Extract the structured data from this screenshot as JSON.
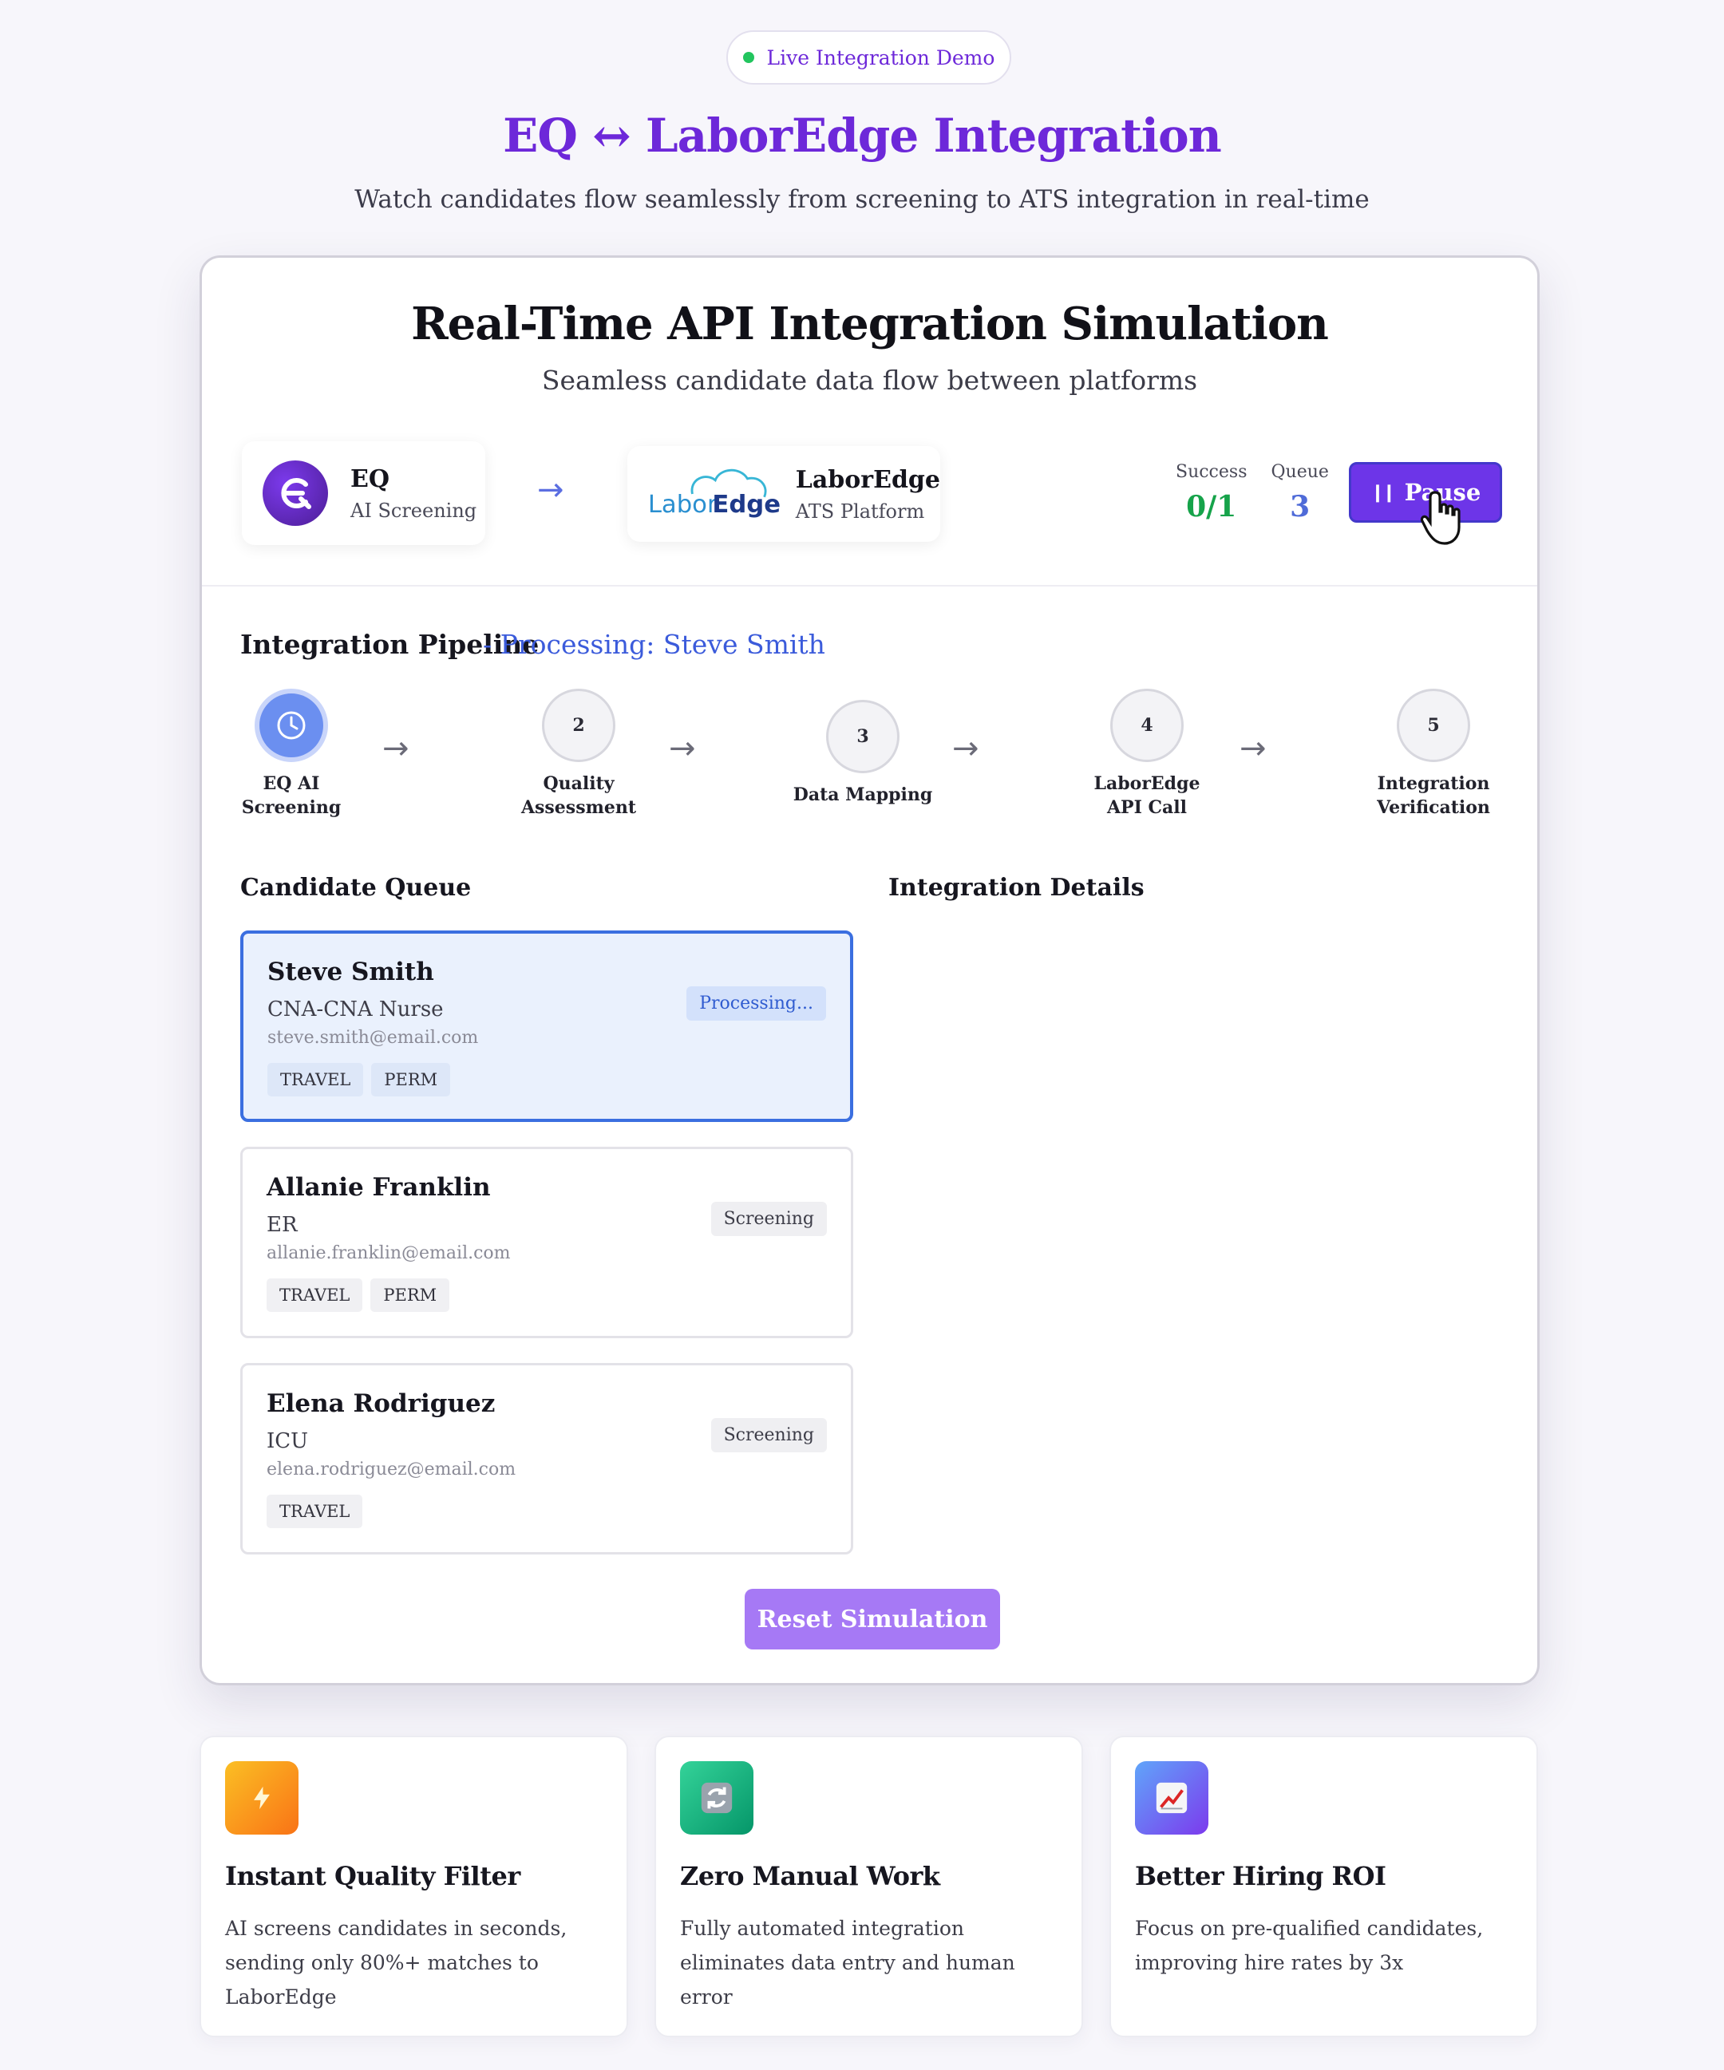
{
  "header": {
    "badge": "Live Integration Demo",
    "title": "EQ ↔ LaborEdge Integration",
    "subtitle": "Watch candidates flow seamlessly from screening to ATS integration in real-time"
  },
  "simulation": {
    "title": "Real-Time API Integration Simulation",
    "subtitle": "Seamless candidate data flow between platforms",
    "source": {
      "name": "EQ",
      "desc": "AI Screening",
      "icon": "eq-logo-icon"
    },
    "target": {
      "name": "LaborEdge",
      "desc": "ATS Platform",
      "logo_text_1": "Labor",
      "logo_text_2": "Edge",
      "icon": "laboredge-logo-icon"
    },
    "stats": {
      "success_label": "Success",
      "success_value": "0/1",
      "queue_label": "Queue",
      "queue_value": "3"
    },
    "pause_label": "Pause",
    "pipeline": {
      "title": "Integration Pipeline",
      "processing": "- Processing: Steve Smith",
      "steps": [
        {
          "num": "",
          "line1": "EQ AI",
          "line2": "Screening"
        },
        {
          "num": "2",
          "line1": "Quality",
          "line2": "Assessment"
        },
        {
          "num": "3",
          "line1": "Data Mapping",
          "line2": ""
        },
        {
          "num": "4",
          "line1": "LaborEdge",
          "line2": "API Call"
        },
        {
          "num": "5",
          "line1": "Integration",
          "line2": "Verification"
        }
      ]
    },
    "queue_title": "Candidate Queue",
    "details_title": "Integration Details",
    "candidates": [
      {
        "name": "Steve Smith",
        "role": "CNA-CNA Nurse",
        "email": "steve.smith@email.com",
        "tags": [
          "TRAVEL",
          "PERM"
        ],
        "status": "Processing..."
      },
      {
        "name": "Allanie Franklin",
        "role": "ER",
        "email": "allanie.franklin@email.com",
        "tags": [
          "TRAVEL",
          "PERM"
        ],
        "status": "Screening"
      },
      {
        "name": "Elena Rodriguez",
        "role": "ICU",
        "email": "elena.rodriguez@email.com",
        "tags": [
          "TRAVEL"
        ],
        "status": "Screening"
      }
    ],
    "reset_label": "Reset Simulation"
  },
  "features": [
    {
      "icon": "lightning-icon",
      "title": "Instant Quality Filter",
      "desc": "AI screens candidates in seconds, sending only 80%+ matches to LaborEdge"
    },
    {
      "icon": "refresh-icon",
      "title": "Zero Manual Work",
      "desc": "Fully automated integration eliminates data entry and human error"
    },
    {
      "icon": "chart-up-icon",
      "title": "Better Hiring ROI",
      "desc": "Focus on pre-qualified candidates, improving hire rates by 3x"
    }
  ],
  "colors": {
    "brand_purple": "#6d28d9",
    "processing_blue": "#3b5bdb",
    "success_green": "#16a34a",
    "reset_button": "#a679f5"
  }
}
